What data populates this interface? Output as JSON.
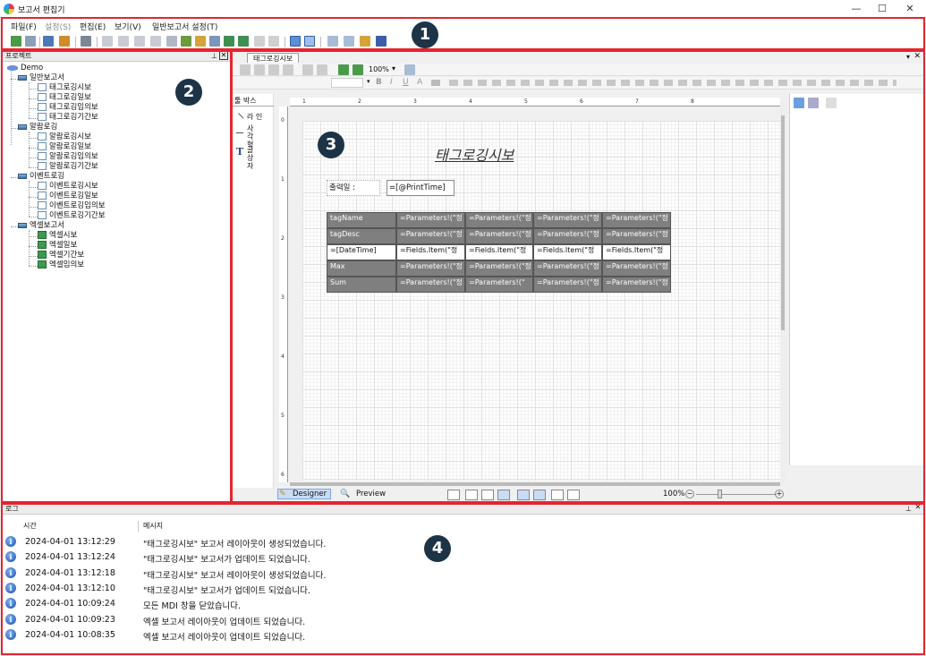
{
  "window": {
    "title": "보고서 편집기",
    "minimize": "—",
    "maximize": "☐",
    "close": "✕"
  },
  "menu": [
    {
      "label": "파일(F)",
      "enabled": true
    },
    {
      "label": "설정(S)",
      "enabled": false
    },
    {
      "label": "편집(E)",
      "enabled": true
    },
    {
      "label": "보기(V)",
      "enabled": true
    },
    {
      "label": "일반보고서 설정(T)",
      "enabled": true
    }
  ],
  "callouts": [
    "1",
    "2",
    "3",
    "4"
  ],
  "project": {
    "title": "프로젝트",
    "root": "Demo",
    "groups": [
      {
        "name": "일반보고서",
        "items": [
          "태그로깅시보",
          "태그로깅일보",
          "태그로깅임의보",
          "태그로깅기간보"
        ]
      },
      {
        "name": "알람로깅",
        "items": [
          "알람로깅시보",
          "알람로깅일보",
          "알람로깅임의보",
          "알람로깅기간보"
        ]
      },
      {
        "name": "이벤트로깅",
        "items": [
          "이벤트로깅시보",
          "이벤트로깅일보",
          "이벤트로깅임의보",
          "이벤트로깅기간보"
        ]
      },
      {
        "name": "엑셀보고서",
        "items": [
          "엑셀시보",
          "엑셀일보",
          "엑셀기간보",
          "엑셀임의보"
        ]
      }
    ]
  },
  "designer": {
    "tab": "태그로깅시보",
    "zoom": "100%",
    "toolbox_title": "툴 박스",
    "tools": [
      "라 인",
      "사각형",
      "글상자"
    ],
    "report_title": "태그로깅시보",
    "print_label": "출력일 :",
    "print_value": "=[@PrintTime]",
    "rows": [
      [
        "tagName",
        "=Parameters!(\"정",
        "=Parameters!(\"정",
        "=Parameters!(\"정",
        "=Parameters!(\"정"
      ],
      [
        "tagDesc",
        "=Parameters!(\"정",
        "=Parameters!(\"정",
        "=Parameters!(\"정",
        "=Parameters!(\"정"
      ],
      [
        "=[DateTime]",
        "=Fields.Item(\"정",
        "=Fields.Item(\"정",
        "=Fields.Item(\"정",
        "=Fields.Item(\"정"
      ],
      [
        "Max",
        "=Parameters!(\"정",
        "=Parameters!(\"정",
        "=Parameters!(\"정",
        "=Parameters!(\"정"
      ],
      [
        "Sum",
        "=Parameters!(\"정",
        "=Parameters!(\"",
        "=Parameters!(\"정",
        "=Parameters!(\"정"
      ]
    ],
    "ruler_top": [
      "1",
      "2",
      "3",
      "4",
      "5",
      "6",
      "7",
      "8"
    ],
    "ruler_left": [
      "0",
      "1",
      "2",
      "3",
      "4",
      "5",
      "6"
    ],
    "mode_designer": "Designer",
    "mode_preview": "Preview",
    "zoom_status": "100%"
  },
  "log": {
    "title": "로그",
    "col_time": "시간",
    "col_message": "메시지",
    "entries": [
      {
        "time": "2024-04-01 13:12:29",
        "message": "\"태그로깅시보\" 보고서 레이아웃이 생성되었습니다."
      },
      {
        "time": "2024-04-01 13:12:24",
        "message": "\"태그로깅시보\" 보고서가 업데이트 되었습니다."
      },
      {
        "time": "2024-04-01 13:12:18",
        "message": "\"태그로깅시보\" 보고서 레이아웃이 생성되었습니다."
      },
      {
        "time": "2024-04-01 13:12:10",
        "message": "\"태그로깅시보\" 보고서가 업데이트 되었습니다."
      },
      {
        "time": "2024-04-01 10:09:24",
        "message": "모든 MDI 창을 닫았습니다."
      },
      {
        "time": "2024-04-01 10:09:23",
        "message": "엑셀 보고서 레이아웃이 업데이트 되었습니다."
      },
      {
        "time": "2024-04-01 10:08:35",
        "message": "엑셀 보고서 레이아웃이 업데이트 되었습니다."
      }
    ]
  },
  "colors": {
    "accent": "#e4252f",
    "badge": "#1d3346",
    "cell_dark": "#7f7f7f"
  }
}
